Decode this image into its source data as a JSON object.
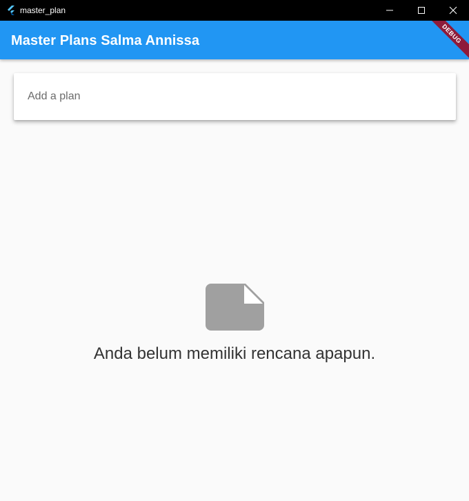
{
  "window": {
    "title": "master_plan",
    "app_icon": "flutter-icon",
    "controls": [
      "minimize-icon",
      "maximize-icon",
      "close-icon"
    ]
  },
  "appbar": {
    "title": "Master Plans Salma Annissa",
    "background": "#2196f3",
    "debug_banner": "DEBUG"
  },
  "add_plan": {
    "value": "",
    "placeholder": "Add a plan"
  },
  "empty_state": {
    "icon": "note-icon",
    "message": "Anda belum memiliki rencana apapun."
  },
  "colors": {
    "accent": "#2196f3",
    "debug_banner": "#8e1b3a",
    "icon_gray": "#a0a0a0",
    "background": "#fafafa"
  }
}
